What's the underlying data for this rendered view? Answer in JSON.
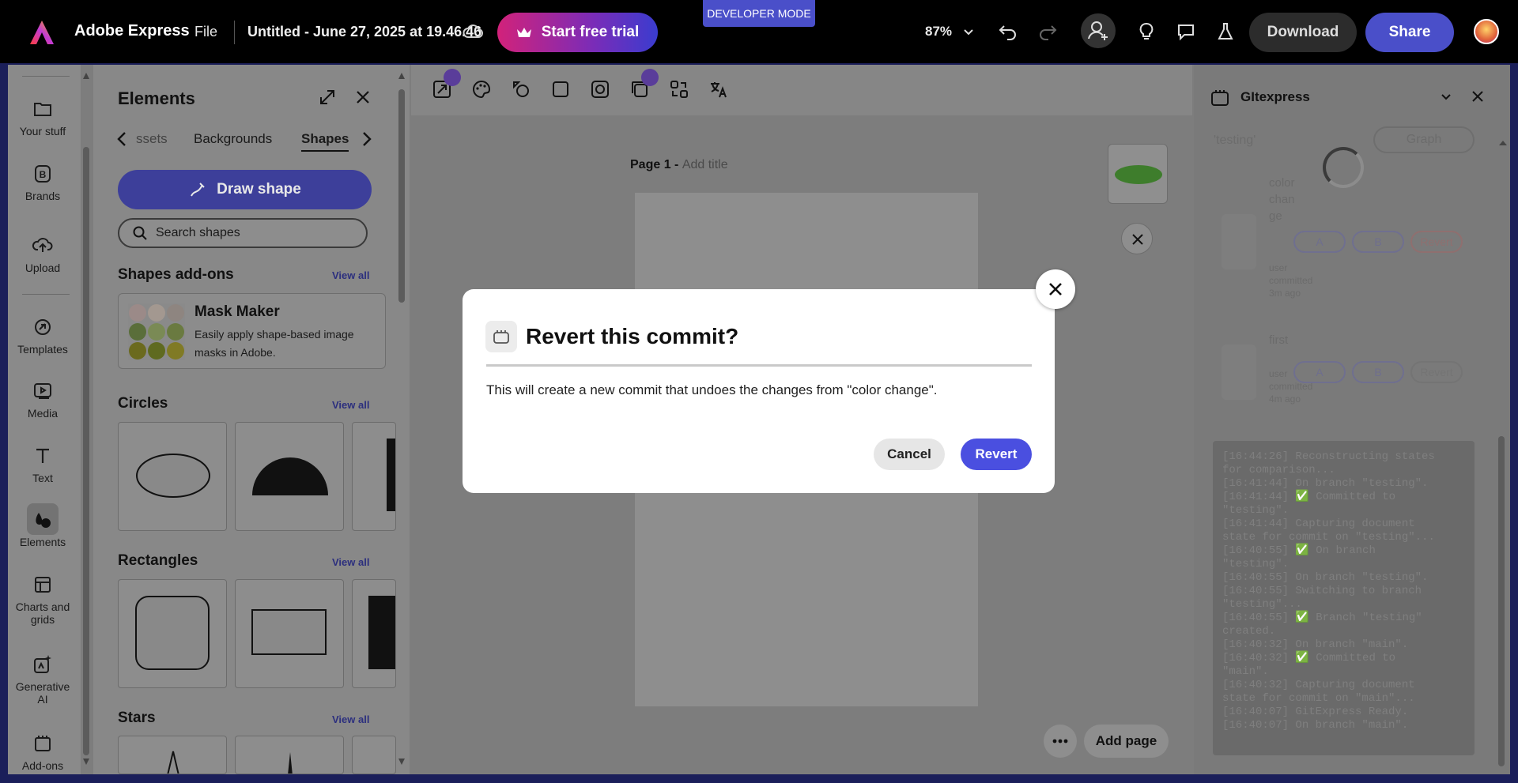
{
  "topbar": {
    "app_name": "Adobe Express",
    "file_label": "File",
    "doc_title": "Untitled - June 27, 2025 at 19.46.46",
    "trial_label": "Start free trial",
    "dev_mode_label": "DEVELOPER MODE",
    "zoom": "87%",
    "download_label": "Download",
    "share_label": "Share"
  },
  "rail": {
    "items": [
      {
        "label": "Your stuff",
        "icon": "folder-icon"
      },
      {
        "label": "Brands",
        "icon": "brand-icon"
      },
      {
        "label": "Upload",
        "icon": "upload-icon"
      },
      {
        "label": "Templates",
        "icon": "templates-icon"
      },
      {
        "label": "Media",
        "icon": "media-icon"
      },
      {
        "label": "Text",
        "icon": "text-icon"
      },
      {
        "label": "Elements",
        "icon": "elements-icon"
      },
      {
        "label": "Charts and grids",
        "icon": "charts-icon"
      },
      {
        "label": "Generative AI",
        "icon": "generative-ai-icon"
      },
      {
        "label": "Add-ons",
        "icon": "addons-icon"
      }
    ],
    "active": "Elements"
  },
  "elements_panel": {
    "title": "Elements",
    "tabs": [
      "Assets",
      "Backgrounds",
      "Shapes"
    ],
    "tab_assets_visible": "ssets",
    "active_tab": "Shapes",
    "draw_shape_label": "Draw shape",
    "search_placeholder": "Search shapes",
    "addons_title": "Shapes add-ons",
    "view_all": "View all",
    "addon": {
      "name": "Mask Maker",
      "description": "Easily apply shape-based image masks in Adobe."
    },
    "sections": [
      "Circles",
      "Rectangles",
      "Stars"
    ]
  },
  "canvas": {
    "page_label": "Page 1 - ",
    "add_title": "Add title",
    "add_page_label": "Add page"
  },
  "gitexpress": {
    "title": "GItexpress",
    "branch_label": "'testing'",
    "graph_label": "Graph",
    "commits": [
      {
        "message": "color change",
        "meta": "user committed 3m ago",
        "a": "A",
        "b": "B",
        "revert": "Revert"
      },
      {
        "message": "first",
        "meta": "user committed 4m ago",
        "a": "A",
        "b": "B",
        "revert": "Revert"
      }
    ],
    "log": [
      "[16:44:26] Reconstructing states",
      "for comparison...",
      "[16:41:44] On branch \"testing\".",
      "[16:41:44] ✅ Committed to",
      "\"testing\".",
      "[16:41:44] Capturing document",
      "state for commit on \"testing\"...",
      "[16:40:55] ✅ On branch",
      "\"testing\".",
      "[16:40:55] On branch \"testing\".",
      "[16:40:55] Switching to branch",
      "\"testing\"...",
      "[16:40:55] ✅ Branch \"testing\"",
      "created.",
      "[16:40:32] On branch \"main\".",
      "[16:40:32] ✅ Committed to",
      "\"main\".",
      "[16:40:32] Capturing document",
      "state for commit on \"main\"...",
      "[16:40:07] GitExpress Ready.",
      "[16:40:07] On branch \"main\"."
    ]
  },
  "dialog": {
    "title": "Revert this commit?",
    "body": "This will create a new commit that undoes the changes from \"color change\".",
    "cancel_label": "Cancel",
    "revert_label": "Revert"
  },
  "colors": {
    "accent": "#4a4fe0",
    "dev_mode": "#4a4fc9",
    "thumb_shape": "#3e7d2c"
  }
}
